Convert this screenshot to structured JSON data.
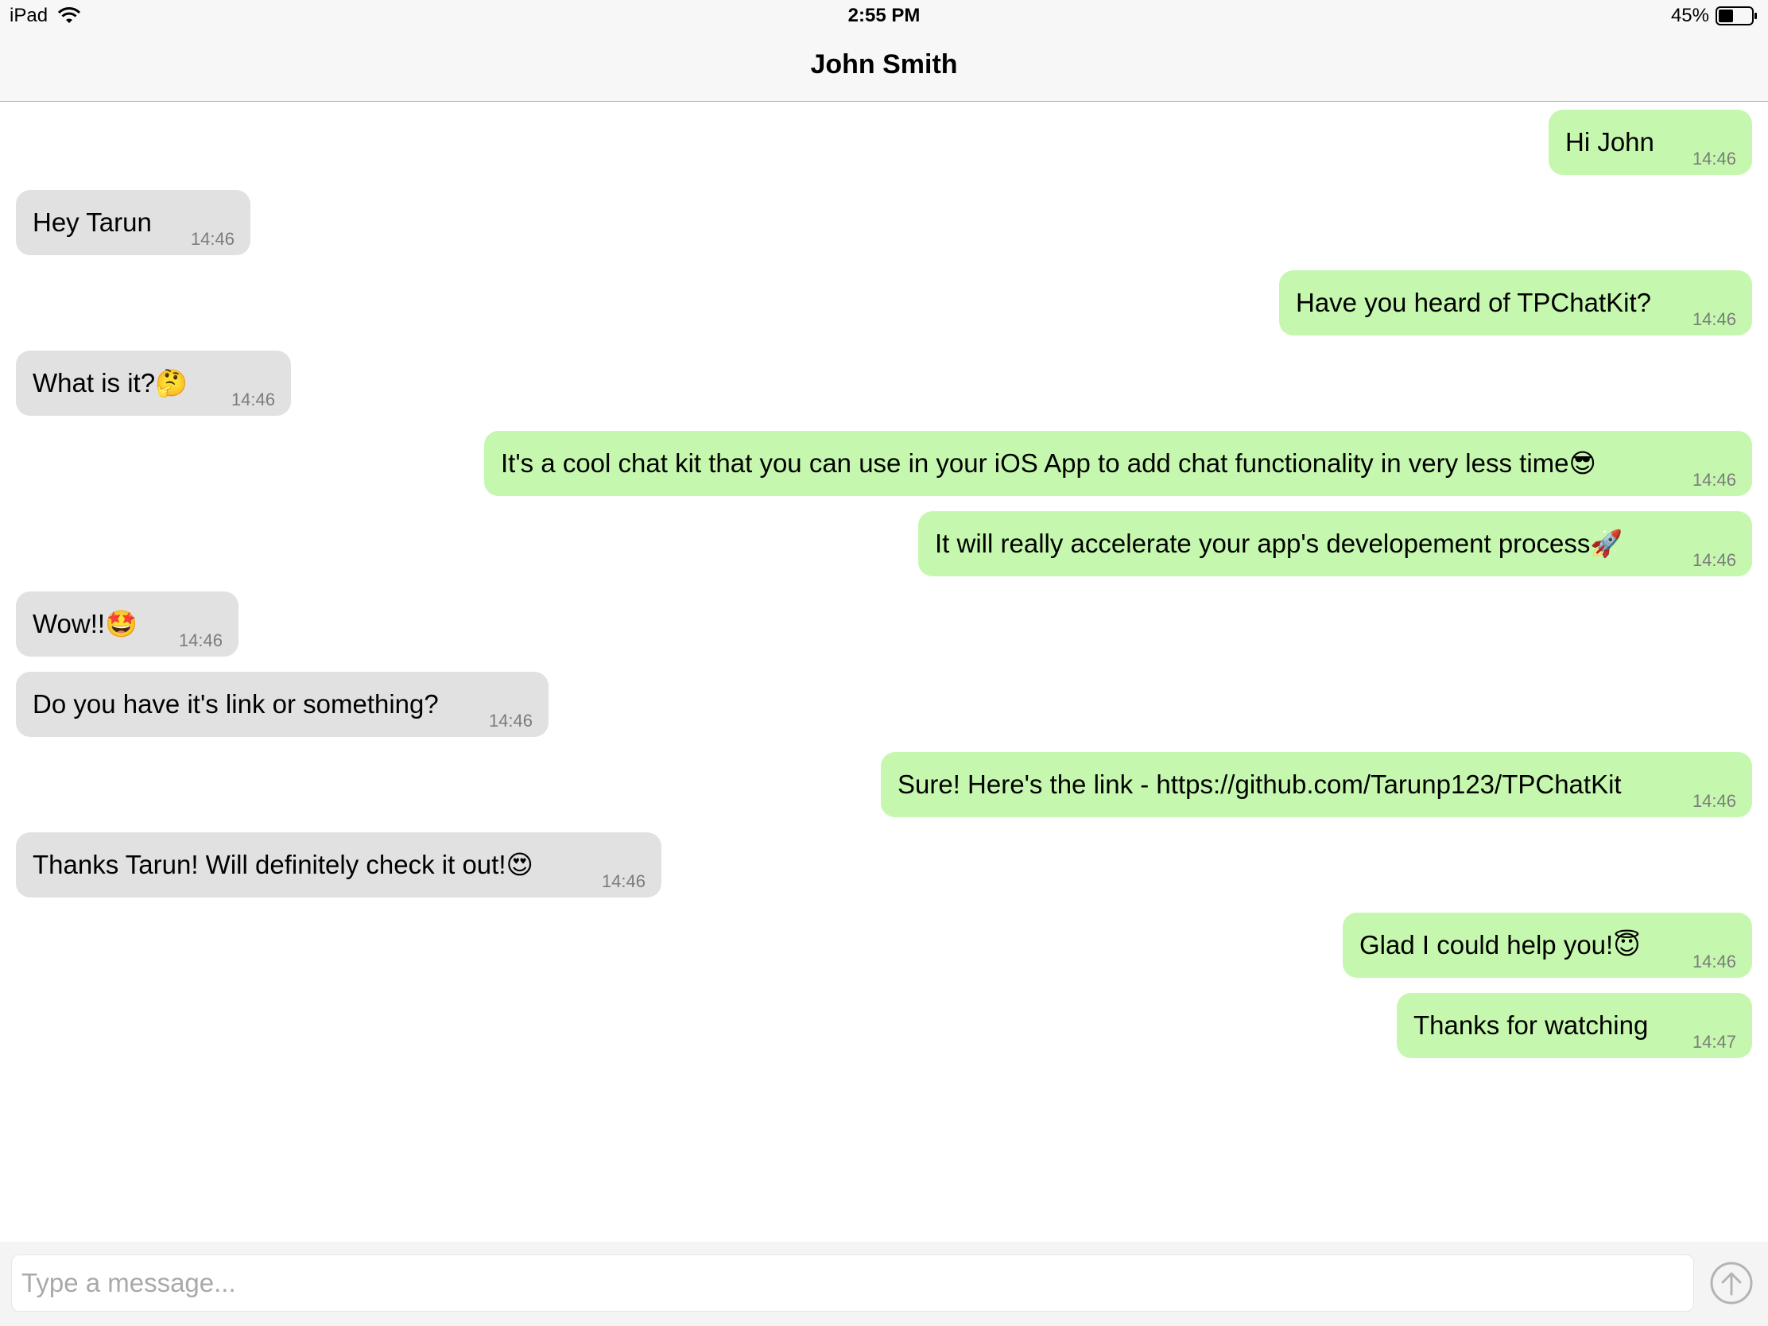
{
  "status_bar": {
    "device": "iPad",
    "time": "2:55 PM",
    "battery_percent": "45%",
    "battery_level": 0.45,
    "icons": [
      "wifi-icon",
      "battery-icon"
    ]
  },
  "header": {
    "title": "John Smith"
  },
  "messages": [
    {
      "direction": "outgoing",
      "text": "Hi John",
      "time": "14:46"
    },
    {
      "direction": "incoming",
      "text": "Hey Tarun",
      "time": "14:46"
    },
    {
      "direction": "outgoing",
      "text": "Have you heard of TPChatKit?",
      "time": "14:46"
    },
    {
      "direction": "incoming",
      "text": "What is it?🤔",
      "time": "14:46"
    },
    {
      "direction": "outgoing",
      "text": "It's a cool chat kit that you can use in your iOS App to add chat functionality in very less time😎",
      "time": "14:46"
    },
    {
      "direction": "outgoing",
      "text": "It will really accelerate your app's developement process🚀",
      "time": "14:46"
    },
    {
      "direction": "incoming",
      "text": "Wow!!🤩",
      "time": "14:46"
    },
    {
      "direction": "incoming",
      "text": "Do you have it's link or something?",
      "time": "14:46"
    },
    {
      "direction": "outgoing",
      "text": "Sure! Here's the link - https://github.com/Tarunp123/TPChatKit",
      "time": "14:46"
    },
    {
      "direction": "incoming",
      "text": "Thanks Tarun! Will definitely check it out!😍",
      "time": "14:46"
    },
    {
      "direction": "outgoing",
      "text": "Glad I could help you!😇",
      "time": "14:46"
    },
    {
      "direction": "outgoing",
      "text": "Thanks for watching",
      "time": "14:47"
    }
  ],
  "composer": {
    "placeholder": "Type a message...",
    "value": "",
    "send_icon": "arrow-up-circle-icon"
  },
  "colors": {
    "outgoing_bubble": "#c5f8ae",
    "incoming_bubble": "#e1e1e1",
    "timestamp": "#7c7c7c",
    "bar_background": "#f7f7f7"
  }
}
